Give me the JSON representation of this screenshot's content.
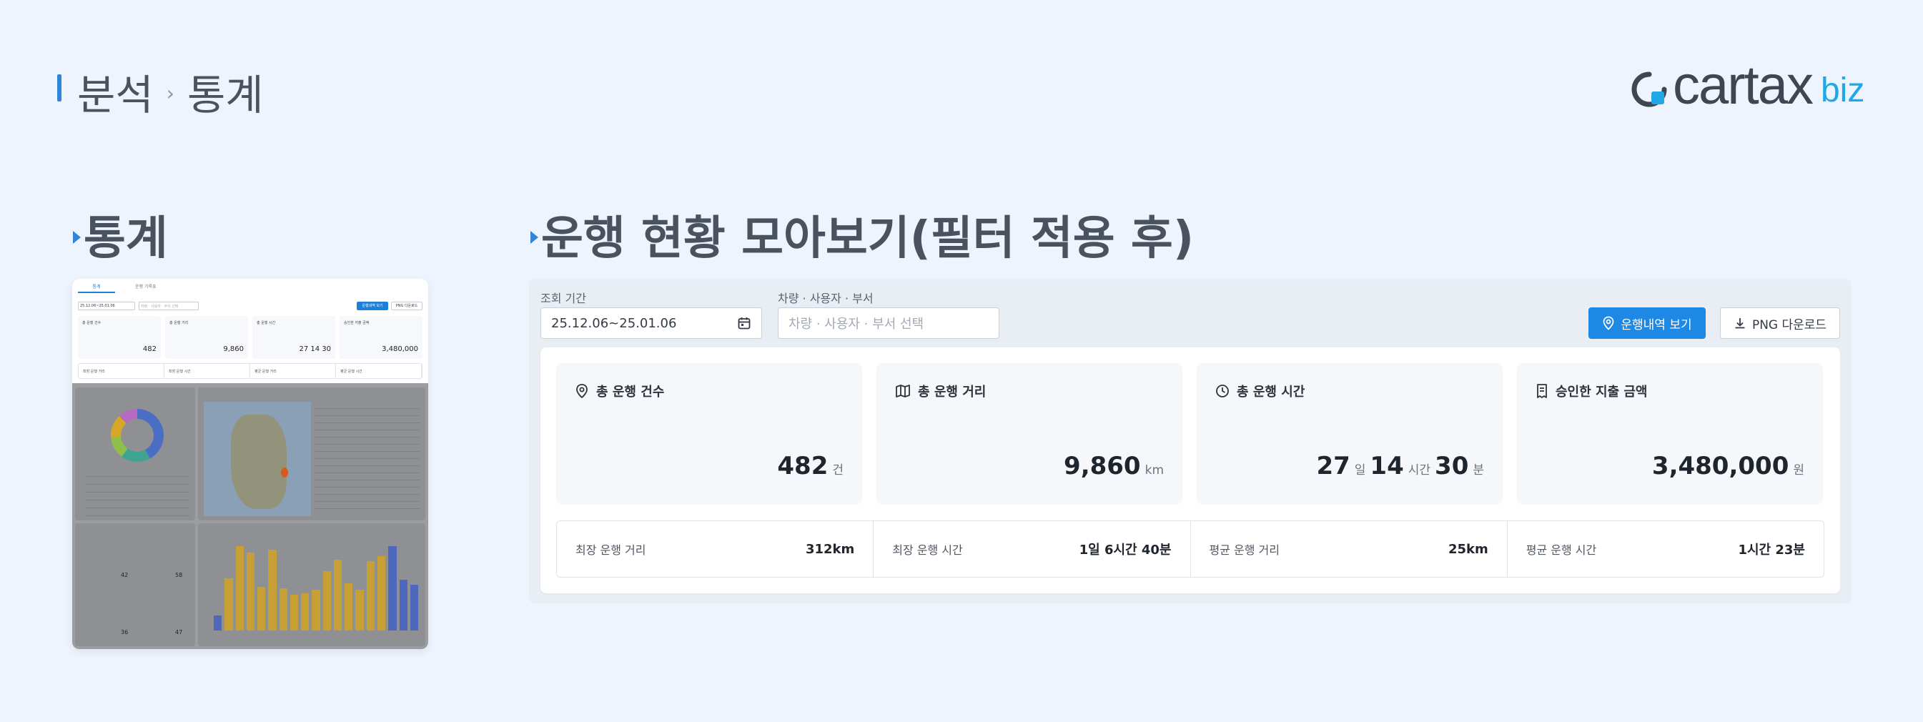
{
  "header": {
    "crumb1": "분석",
    "crumb2": "통계"
  },
  "logo": {
    "text": "cartax",
    "suffix": "biz",
    "brand_color": "#1fa7e8"
  },
  "sections": {
    "left_title": "통계",
    "right_title": "운행 현황 모아보기(필터 적용 후)"
  },
  "thumbnail": {
    "tabs": [
      "통계",
      "운행 기록표"
    ],
    "date": "25.12.06~25.01.06",
    "vehicle_placeholder": "차량 · 사용자 · 부서 선택",
    "btn_view": "운행내역 보기",
    "btn_png": "PNG 다운로드",
    "cards": [
      {
        "label": "총 운행 건수",
        "value": "482"
      },
      {
        "label": "총 운행 거리",
        "value": "9,860"
      },
      {
        "label": "총 운행 시간",
        "value": "27 14 30"
      },
      {
        "label": "승인한 지출 금액",
        "value": "3,480,000"
      }
    ],
    "numbers": [
      "42",
      "58",
      "36",
      "47"
    ]
  },
  "filters": {
    "period_label": "조회 기간",
    "period_value": "25.12.06~25.01.06",
    "vehicle_label": "차량 · 사용자 · 부서",
    "vehicle_placeholder": "차량 · 사용자 · 부서 선택"
  },
  "buttons": {
    "view_history": "운행내역 보기",
    "png_download": "PNG 다운로드"
  },
  "cards": {
    "trips": {
      "label": "총 운행 건수",
      "value": "482",
      "unit": "건"
    },
    "distance": {
      "label": "총 운행 거리",
      "value": "9,860",
      "unit": "km"
    },
    "time": {
      "label": "총 운행 시간",
      "days": "27",
      "days_unit": "일",
      "hours": "14",
      "hours_unit": "시간",
      "minutes": "30",
      "minutes_unit": "분"
    },
    "expense": {
      "label": "승인한 지출 금액",
      "value": "3,480,000",
      "unit": "원"
    }
  },
  "stats": [
    {
      "label": "최장 운행 거리",
      "value": "312km"
    },
    {
      "label": "최장 운행 시간",
      "value": "1일 6시간 40분"
    },
    {
      "label": "평균 운행 거리",
      "value": "25km"
    },
    {
      "label": "평균 운행 시간",
      "value": "1시간 23분"
    }
  ],
  "icons": [
    "pin-icon",
    "map-icon",
    "clock-icon",
    "receipt-icon",
    "calendar-icon",
    "download-icon"
  ],
  "colors": {
    "accent": "#1e88e5",
    "background": "#eef4fd"
  }
}
